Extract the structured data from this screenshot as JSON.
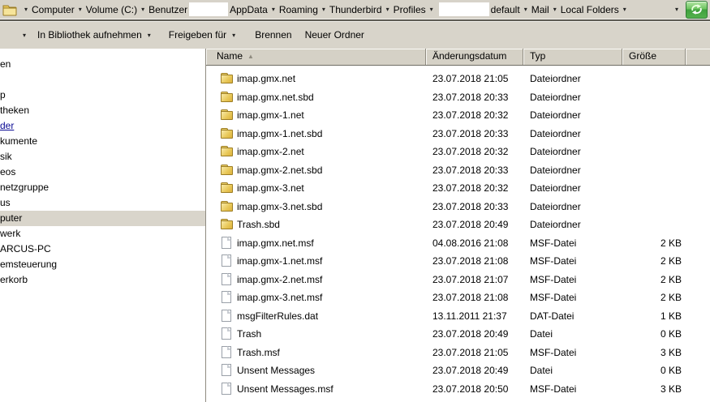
{
  "colors": {
    "chrome_gray": "#d7d3c9",
    "header_gray": "#d5d1c6",
    "selection_gray": "#d9d5cb",
    "link_blue": "#0a0a94",
    "refresh_green": "#53b14c",
    "folder_yellow": "#e8c757"
  },
  "address_bar": {
    "separator_glyph": "▾",
    "history_arrow_glyph": "▾",
    "items": [
      {
        "type": "sep"
      },
      {
        "type": "crumb",
        "label": "Computer"
      },
      {
        "type": "sep"
      },
      {
        "type": "crumb",
        "label": "Volume (C:)"
      },
      {
        "type": "sep"
      },
      {
        "type": "crumb",
        "label": "Benutzer"
      },
      {
        "type": "redaction"
      },
      {
        "type": "crumb",
        "label": "AppData"
      },
      {
        "type": "sep"
      },
      {
        "type": "crumb",
        "label": "Roaming"
      },
      {
        "type": "sep"
      },
      {
        "type": "crumb",
        "label": "Thunderbird"
      },
      {
        "type": "sep"
      },
      {
        "type": "crumb",
        "label": "Profiles"
      },
      {
        "type": "sep"
      },
      {
        "type": "redaction",
        "wide": true
      },
      {
        "type": "crumb",
        "label": "default"
      },
      {
        "type": "sep"
      },
      {
        "type": "crumb",
        "label": "Mail"
      },
      {
        "type": "sep"
      },
      {
        "type": "crumb",
        "label": "Local Folders"
      },
      {
        "type": "sep"
      }
    ]
  },
  "toolbar": {
    "overflow_arrow_glyph": "▾",
    "items": [
      {
        "label": "In Bibliothek aufnehmen",
        "dropdown": true
      },
      {
        "label": "Freigeben für",
        "dropdown": true
      },
      {
        "label": "Brennen",
        "dropdown": false
      },
      {
        "label": "Neuer Ordner",
        "dropdown": false
      }
    ]
  },
  "sidebar": {
    "items": [
      {
        "label": "en",
        "row": 0
      },
      {
        "label": "p",
        "row": 2
      },
      {
        "label": "theken",
        "row": 3
      },
      {
        "label": "der",
        "row": 4,
        "link": true
      },
      {
        "label": "kumente",
        "row": 5
      },
      {
        "label": "sik",
        "row": 6
      },
      {
        "label": "eos",
        "row": 7
      },
      {
        "label": "netzgruppe",
        "row": 8
      },
      {
        "label": "us",
        "row": 9
      },
      {
        "label": "puter",
        "row": 10,
        "selected": true
      },
      {
        "label": "werk",
        "row": 11
      },
      {
        "label": "ARCUS-PC",
        "row": 12
      },
      {
        "label": "emsteuerung",
        "row": 13
      },
      {
        "label": "erkorb",
        "row": 14
      }
    ]
  },
  "file_list": {
    "columns": [
      {
        "label": "Name",
        "sort": "asc"
      },
      {
        "label": "Änderungsdatum"
      },
      {
        "label": "Typ"
      },
      {
        "label": "Größe"
      }
    ],
    "rows": [
      {
        "name": "imap.gmx.net",
        "icon": "folder",
        "date": "23.07.2018 21:05",
        "type": "Dateiordner",
        "size": ""
      },
      {
        "name": "imap.gmx.net.sbd",
        "icon": "folder",
        "date": "23.07.2018 20:33",
        "type": "Dateiordner",
        "size": ""
      },
      {
        "name": "imap.gmx-1.net",
        "icon": "folder",
        "date": "23.07.2018 20:32",
        "type": "Dateiordner",
        "size": ""
      },
      {
        "name": "imap.gmx-1.net.sbd",
        "icon": "folder",
        "date": "23.07.2018 20:33",
        "type": "Dateiordner",
        "size": ""
      },
      {
        "name": "imap.gmx-2.net",
        "icon": "folder",
        "date": "23.07.2018 20:32",
        "type": "Dateiordner",
        "size": ""
      },
      {
        "name": "imap.gmx-2.net.sbd",
        "icon": "folder",
        "date": "23.07.2018 20:33",
        "type": "Dateiordner",
        "size": ""
      },
      {
        "name": "imap.gmx-3.net",
        "icon": "folder",
        "date": "23.07.2018 20:32",
        "type": "Dateiordner",
        "size": ""
      },
      {
        "name": "imap.gmx-3.net.sbd",
        "icon": "folder",
        "date": "23.07.2018 20:33",
        "type": "Dateiordner",
        "size": ""
      },
      {
        "name": "Trash.sbd",
        "icon": "folder",
        "date": "23.07.2018 20:49",
        "type": "Dateiordner",
        "size": ""
      },
      {
        "name": "imap.gmx.net.msf",
        "icon": "file",
        "date": "04.08.2016 21:08",
        "type": "MSF-Datei",
        "size": "2 KB"
      },
      {
        "name": "imap.gmx-1.net.msf",
        "icon": "file",
        "date": "23.07.2018 21:08",
        "type": "MSF-Datei",
        "size": "2 KB"
      },
      {
        "name": "imap.gmx-2.net.msf",
        "icon": "file",
        "date": "23.07.2018 21:07",
        "type": "MSF-Datei",
        "size": "2 KB"
      },
      {
        "name": "imap.gmx-3.net.msf",
        "icon": "file",
        "date": "23.07.2018 21:08",
        "type": "MSF-Datei",
        "size": "2 KB"
      },
      {
        "name": "msgFilterRules.dat",
        "icon": "file",
        "date": "13.11.2011 21:37",
        "type": "DAT-Datei",
        "size": "1 KB"
      },
      {
        "name": "Trash",
        "icon": "file",
        "date": "23.07.2018 20:49",
        "type": "Datei",
        "size": "0 KB"
      },
      {
        "name": "Trash.msf",
        "icon": "file",
        "date": "23.07.2018 21:05",
        "type": "MSF-Datei",
        "size": "3 KB"
      },
      {
        "name": "Unsent Messages",
        "icon": "file",
        "date": "23.07.2018 20:49",
        "type": "Datei",
        "size": "0 KB"
      },
      {
        "name": "Unsent Messages.msf",
        "icon": "file",
        "date": "23.07.2018 20:50",
        "type": "MSF-Datei",
        "size": "3 KB"
      }
    ]
  }
}
